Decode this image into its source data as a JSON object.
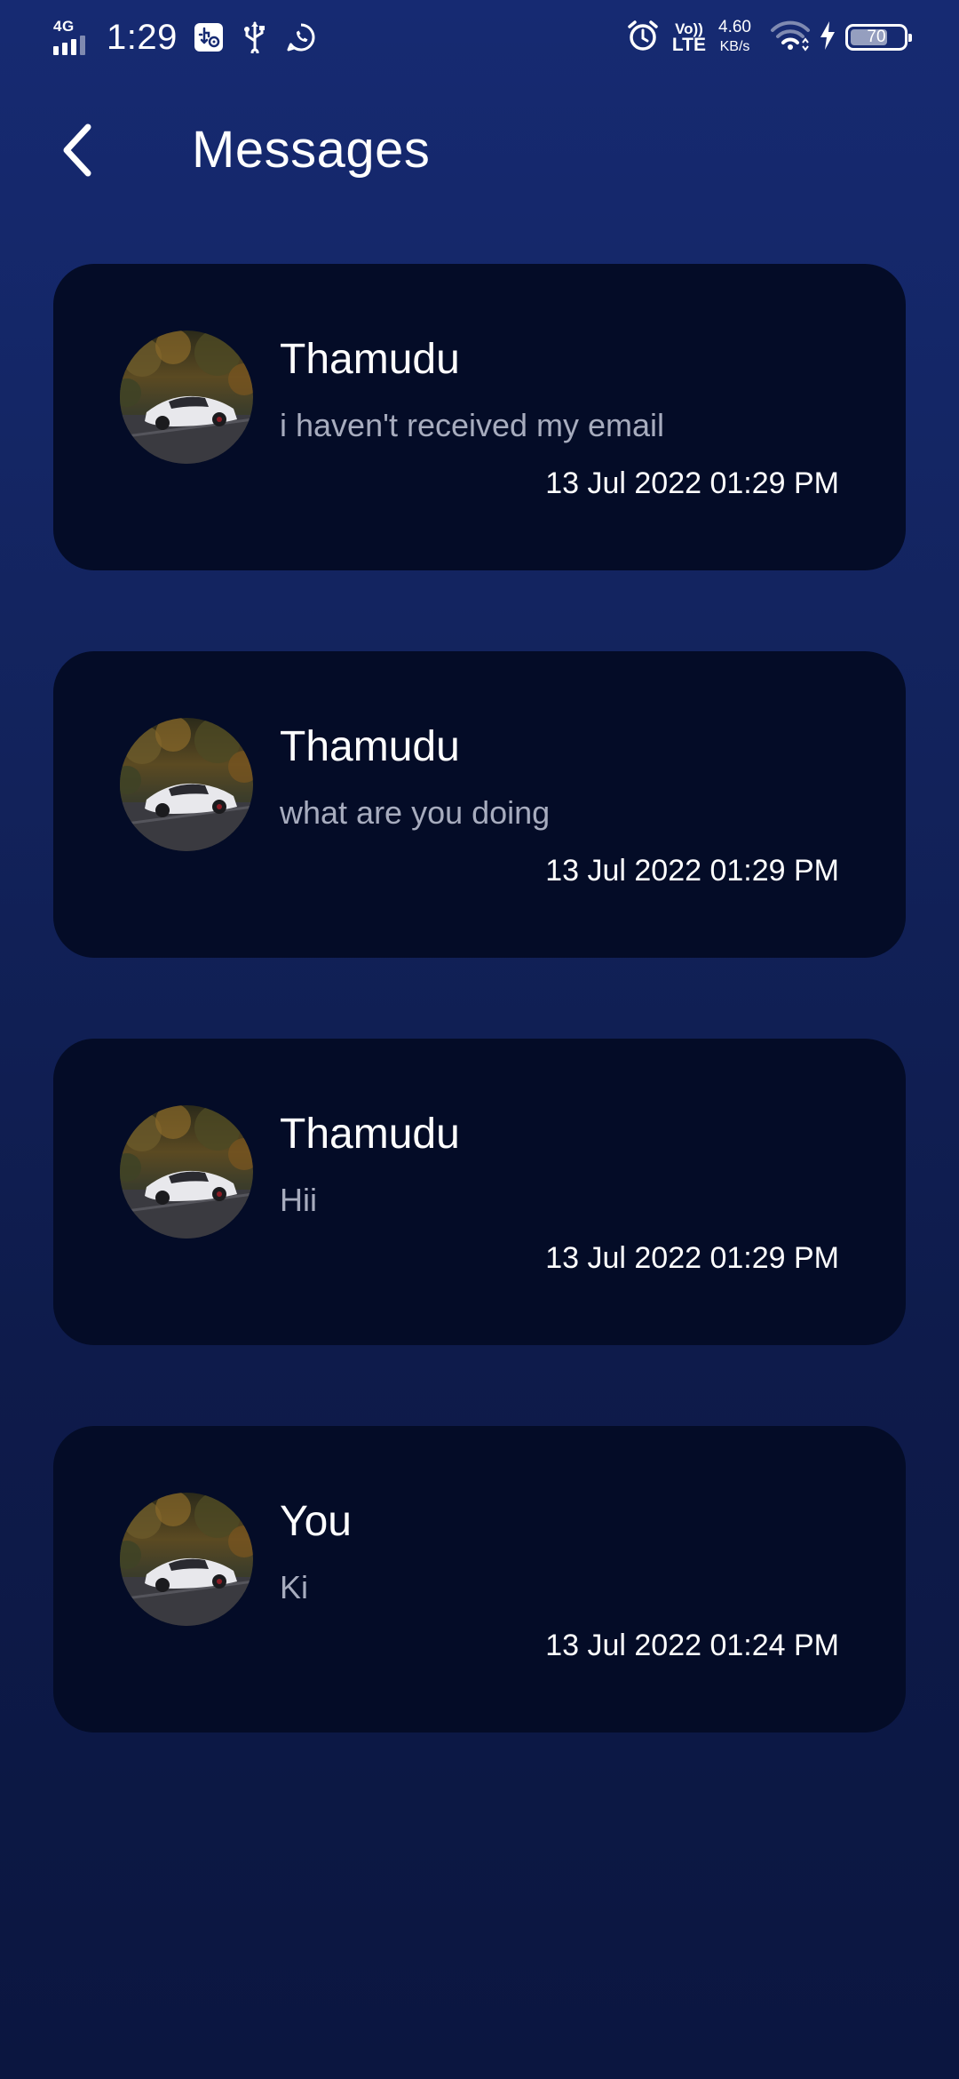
{
  "status_bar": {
    "network_type": "4G",
    "time": "1:29",
    "volte_top": "Vo))",
    "volte_bottom": "LTE",
    "speed_value": "4.60",
    "speed_unit": "KB/s",
    "battery_percent": "70",
    "battery_level": 0.7,
    "icons": [
      "signal-icon",
      "usb-settings-icon",
      "usb-icon",
      "whatsapp-icon",
      "alarm-icon",
      "wifi-icon",
      "charging-icon",
      "battery-icon"
    ]
  },
  "header": {
    "back_icon": "chevron-left-icon",
    "title": "Messages"
  },
  "messages": [
    {
      "sender": "Thamudu",
      "preview": "i haven't received my email",
      "timestamp": "13 Jul 2022 01:29 PM"
    },
    {
      "sender": "Thamudu",
      "preview": "what are you doing",
      "timestamp": "13 Jul 2022 01:29 PM"
    },
    {
      "sender": "Thamudu",
      "preview": "Hii",
      "timestamp": "13 Jul 2022 01:29 PM"
    },
    {
      "sender": "You",
      "preview": "Ki",
      "timestamp": "13 Jul 2022 01:24 PM"
    }
  ],
  "colors": {
    "background_top": "#162a72",
    "background_bottom": "#0b1640",
    "card": "#040c27",
    "preview_text": "#a7acbe"
  }
}
